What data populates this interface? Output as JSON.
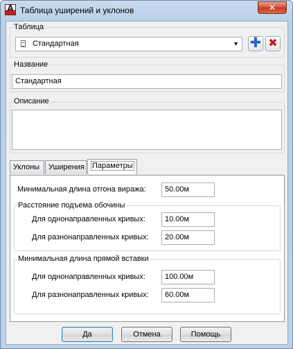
{
  "window": {
    "title": "Таблица уширений и уклонов",
    "close_glyph": "✕",
    "icon_letter": "A"
  },
  "table_group": {
    "label": "Таблица",
    "selected": "Стандартная",
    "add_glyph": "✚",
    "delete_glyph": "✖"
  },
  "name_group": {
    "label": "Название",
    "value": "Стандартная"
  },
  "description_group": {
    "label": "Описание",
    "value": ""
  },
  "tabs": [
    {
      "label": "Уклоны"
    },
    {
      "label": "Уширения"
    },
    {
      "label": "Параметры",
      "active": true
    }
  ],
  "parameters": {
    "min_runoff_label": "Минимальная длина отгона виража:",
    "min_runoff_value": "50.00м",
    "shoulder_group": {
      "label": "Расстояние подъема обочины",
      "same_dir_label": "Для однонаправленных кривых:",
      "same_dir_value": "10.00м",
      "opp_dir_label": "Для разнонаправленных кривых:",
      "opp_dir_value": "20.00м"
    },
    "tangent_group": {
      "label": "Минимальная длина прямой вставки",
      "same_dir_label": "Для однонаправленных кривых:",
      "same_dir_value": "100.00м",
      "opp_dir_label": "Для разнонаправленных кривых:",
      "opp_dir_value": "60.00м"
    }
  },
  "buttons": {
    "ok": "Да",
    "cancel": "Отмена",
    "help": "Помощь"
  }
}
